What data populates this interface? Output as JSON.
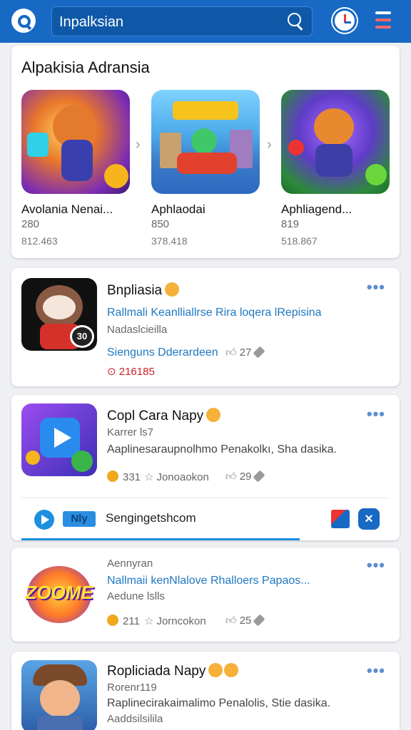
{
  "header": {
    "search_value": "Inpalksian"
  },
  "featured": {
    "title": "Alpakisia Adransia",
    "items": [
      {
        "name": "Avolania Nenai...",
        "count": "280",
        "sub": "812.463"
      },
      {
        "name": "Aphlaodai",
        "count": "850",
        "sub": "378.418"
      },
      {
        "name": "Aphliagend...",
        "count": "819",
        "sub": "518.867"
      }
    ]
  },
  "apps": [
    {
      "title": "Bnpliasia",
      "subtitle": "Rallmali Keanlliallrse Rira loqera lRepisina",
      "meta": "Nadaslcieilla",
      "tags": "Sienguns Dderardeen",
      "likes": "27",
      "price": "216185",
      "badge": "30"
    },
    {
      "title": "Copl Cara Napy",
      "meta": "Karrer  ls7",
      "description": "Aaplinesaraupnolhmo Penakolkı, Sha dasika.",
      "coins": "331",
      "reviews": "Jonoaokon",
      "likes": "29",
      "ad": {
        "brand": "Nly",
        "text": "Sengingetshcom"
      }
    },
    {
      "title": "Aennyran",
      "subtitle": "Nallmaii kenNlalove Rhalloers Papaos...",
      "meta": "Aedune lslls",
      "coins": "211",
      "reviews": "Jorncokon",
      "likes": "25",
      "logo_text": "ZOOME"
    },
    {
      "title": "Ropliciada Napy",
      "meta": "Rorenr119",
      "description": "Raplinecirakaimalimo Penalolis, Stie dasika.",
      "meta2": "Aaddsilsilila"
    }
  ],
  "colors": {
    "topbar": "#1769c4",
    "link_blue": "#1f78c1",
    "price_red": "#cc2222"
  }
}
